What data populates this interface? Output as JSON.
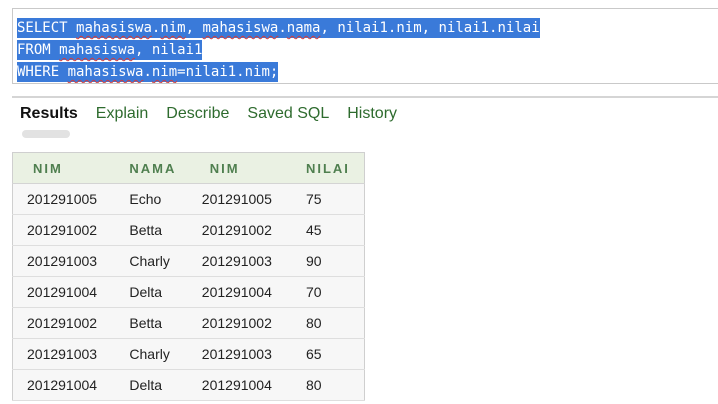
{
  "sql": {
    "line1_keyword": "SELECT ",
    "line1_tbl1": "mahasiswa",
    "line1_rest1": ".",
    "line1_col1": "nim",
    "line1_rest2": ", ",
    "line1_tbl2": "mahasiswa",
    "line1_rest3": ".",
    "line1_col2": "nama",
    "line1_rest4": ", nilai1.nim, nilai1.nilai",
    "line2_keyword": "FROM ",
    "line2_tbl": "mahasiswa",
    "line2_rest": ", nilai1",
    "line3_keyword": "WHERE ",
    "line3_tbl": "mahasiswa",
    "line3_rest": ".",
    "line3_col": "nim",
    "line3_rest2": "=nilai1.nim;",
    "selection_color": "#3a7ad9"
  },
  "tabs": [
    {
      "label": "Results",
      "active": true
    },
    {
      "label": "Explain",
      "active": false
    },
    {
      "label": "Describe",
      "active": false
    },
    {
      "label": "Saved SQL",
      "active": false
    },
    {
      "label": "History",
      "active": false
    }
  ],
  "results": {
    "columns": [
      "NIM",
      "NAMA",
      "NIM",
      "NILAI"
    ],
    "rows": [
      [
        "201291005",
        "Echo",
        "201291005",
        "75"
      ],
      [
        "201291002",
        "Betta",
        "201291002",
        "45"
      ],
      [
        "201291003",
        "Charly",
        "201291003",
        "90"
      ],
      [
        "201291004",
        "Delta",
        "201291004",
        "70"
      ],
      [
        "201291002",
        "Betta",
        "201291002",
        "80"
      ],
      [
        "201291003",
        "Charly",
        "201291003",
        "65"
      ],
      [
        "201291004",
        "Delta",
        "201291004",
        "80"
      ]
    ]
  },
  "colors": {
    "tab_text": "#2e6b2e",
    "header_bg": "#eaf1e3",
    "header_text": "#4f7f4f"
  }
}
